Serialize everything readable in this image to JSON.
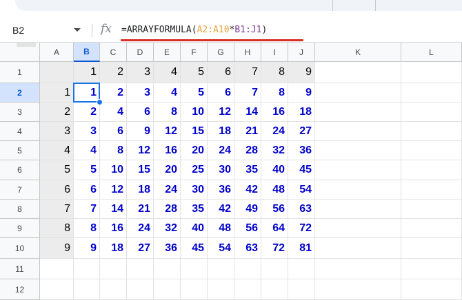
{
  "name_box": "B2",
  "formula_bar": {
    "fx_label": "fx",
    "prefix": "=ARRAYFORMULA(",
    "range1": "A2:A10",
    "operator": "*",
    "range2": "B1:J1",
    "suffix": ")"
  },
  "columns": [
    "A",
    "B",
    "C",
    "D",
    "E",
    "F",
    "G",
    "H",
    "I",
    "J",
    "K",
    "L"
  ],
  "rows": [
    "1",
    "2",
    "3",
    "4",
    "5",
    "6",
    "7",
    "8",
    "9",
    "10",
    "11",
    "12"
  ],
  "active_cell": "B2",
  "header_row_values": [
    "1",
    "2",
    "3",
    "4",
    "5",
    "6",
    "7",
    "8",
    "9"
  ],
  "column_a_values": [
    "1",
    "2",
    "3",
    "4",
    "5",
    "6",
    "7",
    "8",
    "9"
  ],
  "product_table": [
    [
      "1",
      "2",
      "3",
      "4",
      "5",
      "6",
      "7",
      "8",
      "9"
    ],
    [
      "2",
      "4",
      "6",
      "8",
      "10",
      "12",
      "14",
      "16",
      "18"
    ],
    [
      "3",
      "6",
      "9",
      "12",
      "15",
      "18",
      "21",
      "24",
      "27"
    ],
    [
      "4",
      "8",
      "12",
      "16",
      "20",
      "24",
      "28",
      "32",
      "36"
    ],
    [
      "5",
      "10",
      "15",
      "20",
      "25",
      "30",
      "35",
      "40",
      "45"
    ],
    [
      "6",
      "12",
      "18",
      "24",
      "30",
      "36",
      "42",
      "48",
      "54"
    ],
    [
      "7",
      "14",
      "21",
      "28",
      "35",
      "42",
      "49",
      "56",
      "63"
    ],
    [
      "8",
      "16",
      "24",
      "32",
      "40",
      "48",
      "56",
      "64",
      "72"
    ],
    [
      "9",
      "18",
      "27",
      "36",
      "45",
      "54",
      "63",
      "72",
      "81"
    ]
  ],
  "colors": {
    "selection_blue": "#1a73e8",
    "product_text": "#0000cc",
    "underline_red": "#d93025",
    "header_fill": "#ececec"
  }
}
